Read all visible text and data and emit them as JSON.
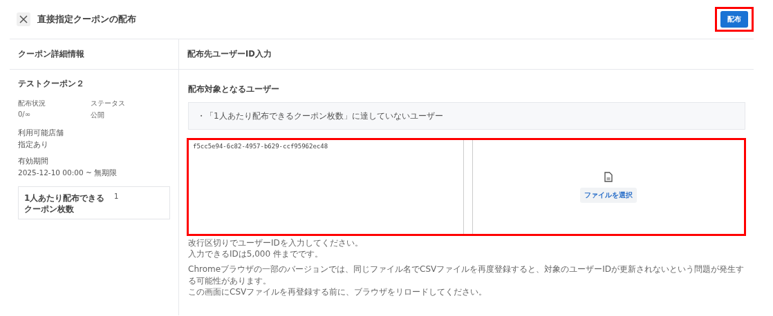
{
  "header": {
    "close_icon": true,
    "title": "直接指定クーポンの配布",
    "action_button": {
      "label": "配布",
      "highlighted": true
    }
  },
  "coupon_panel": {
    "heading": "クーポン詳細情報",
    "name": "テストクーポン２",
    "stats": [
      {
        "label": "配布状況",
        "value": "0/∞"
      },
      {
        "label": "ステータス",
        "value": "公開"
      }
    ],
    "fields": [
      {
        "label": "利用可能店舗",
        "value": "指定あり"
      },
      {
        "label": "有効期間",
        "value": "2025-12-10 00:00 ~ 無期限"
      }
    ],
    "limit": {
      "label": "1人あたり配布できるクーポン枚数",
      "value": "1"
    }
  },
  "input_panel": {
    "heading": "配布先ユーザーID入力",
    "target_heading": "配布対象となるユーザー",
    "target_conditions": [
      "・「1人あたり配布できるクーポン枚数」に達していないユーザー"
    ],
    "id_input": {
      "value": "f5cc5e94-6c82-4957-b629-ccf95962ec48",
      "highlighted": true
    },
    "file_button": {
      "label": "ファイルを選択"
    },
    "help_lines": [
      "改行区切りでユーザーIDを入力してください。",
      "入力できるIDは5,000 件までです。"
    ],
    "notice_lines": [
      "Chromeブラウザの一部のバージョンでは、同じファイル名でCSVファイルを再度登録すると、対象のユーザーIDが更新されないという問題が発生する可能性があります。",
      "この画面にCSVファイルを再登録する前に、ブラウザをリロードしてください。"
    ]
  }
}
